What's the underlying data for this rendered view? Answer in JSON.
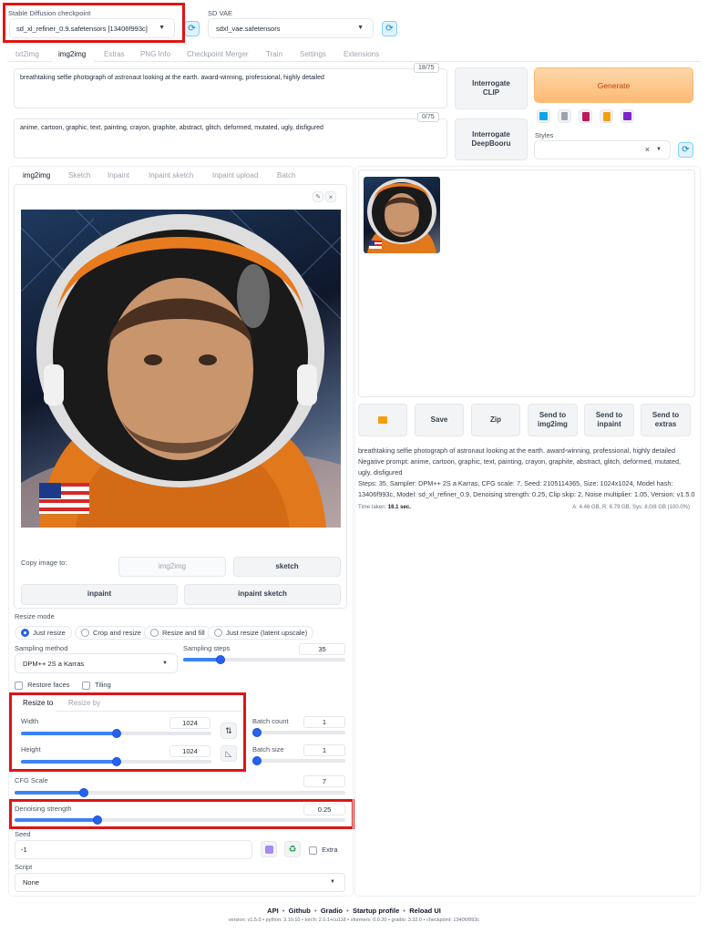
{
  "header": {
    "checkpoint_label": "Stable Diffusion checkpoint",
    "checkpoint_value": "sd_xl_refiner_0.9.safetensors [13406f993c]",
    "vae_label": "SD VAE",
    "vae_value": "sdxl_vae.safetensors"
  },
  "tabs": [
    "txt2img",
    "img2img",
    "Extras",
    "PNG Info",
    "Checkpoint Merger",
    "Train",
    "Settings",
    "Extensions"
  ],
  "prompt": {
    "positive": "breathtaking selfie photograph of astronaut looking at the earth. award-winning, professional, highly detailed",
    "positive_count": "18/75",
    "negative": "anime, cartoon, graphic, text, painting, crayon, graphite, abstract, glitch, deformed, mutated, ugly, disfigured",
    "negative_count": "0/75"
  },
  "buttons": {
    "interrogate_clip": "Interrogate CLIP",
    "interrogate_deepbooru": "Interrogate DeepBooru",
    "generate": "Generate"
  },
  "styles_label": "Styles",
  "sub_tabs": [
    "img2img",
    "Sketch",
    "Inpaint",
    "Inpaint sketch",
    "Inpaint upload",
    "Batch"
  ],
  "copy_image": {
    "label": "Copy image to:",
    "img2img": "img2img",
    "sketch": "sketch",
    "inpaint": "inpaint",
    "inpaint_sketch": "inpaint sketch"
  },
  "resize_mode": {
    "label": "Resize mode",
    "options": [
      "Just resize",
      "Crop and resize",
      "Resize and fill",
      "Just resize (latent upscale)"
    ],
    "selected": "Just resize"
  },
  "sampling": {
    "method_label": "Sampling method",
    "method_value": "DPM++ 2S a Karras",
    "steps_label": "Sampling steps",
    "steps_value": "35",
    "steps_fraction": 0.23
  },
  "checks": {
    "restore_faces": "Restore faces",
    "tiling": "Tiling"
  },
  "resize": {
    "tab_to": "Resize to",
    "tab_by": "Resize by",
    "width_label": "Width",
    "width_value": "1024",
    "width_fraction": 0.5,
    "height_label": "Height",
    "height_value": "1024",
    "height_fraction": 0.5
  },
  "batch": {
    "count_label": "Batch count",
    "count_value": "1",
    "count_fraction": 0.0,
    "size_label": "Batch size",
    "size_value": "1",
    "size_fraction": 0.0
  },
  "cfg": {
    "label": "CFG Scale",
    "value": "7",
    "fraction": 0.21
  },
  "denoise": {
    "label": "Denoising strength",
    "value": "0.25",
    "fraction": 0.25
  },
  "seed": {
    "label": "Seed",
    "value": "-1",
    "extra": "Extra"
  },
  "script": {
    "label": "Script",
    "value": "None"
  },
  "output_buttons": {
    "save": "Save",
    "zip": "Zip",
    "send_img2img": "Send to img2img",
    "send_inpaint": "Send to inpaint",
    "send_extras": "Send to extras"
  },
  "info": {
    "prompt": "breathtaking selfie photograph of astronaut looking at the earth. award-winning, professional, highly detailed",
    "negative": "Negative prompt: anime, cartoon, graphic, text, painting, crayon, graphite, abstract, glitch, deformed, mutated, ugly, disfigured",
    "params": "Steps: 35, Sampler: DPM++ 2S a Karras, CFG scale: 7, Seed: 2105114365, Size: 1024x1024, Model hash: 13406f993c, Model: sd_xl_refiner_0.9, Denoising strength: 0.25, Clip skip: 2, Noise multiplier: 1.05, Version: v1.5.0",
    "time_label": "Time taken:",
    "time_value": "16.1 sec.",
    "memory": "A: 4.46 GB, R: 6.79 GB, Sys: 8.0/8 GB (100.0%)"
  },
  "footer": {
    "links": [
      "API",
      "Github",
      "Gradio",
      "Startup profile",
      "Reload UI"
    ],
    "versions": "version: v1.5.0  •  python: 3.10.10  •  torch: 2.0.1+cu118  •  xformers: 0.0.20  •  gradio: 3.32.0  •  checkpoint: 13406f993c"
  },
  "colors": {
    "accent": "#3b82f6",
    "generate": "#fdba74",
    "highlight": "#e01414"
  }
}
